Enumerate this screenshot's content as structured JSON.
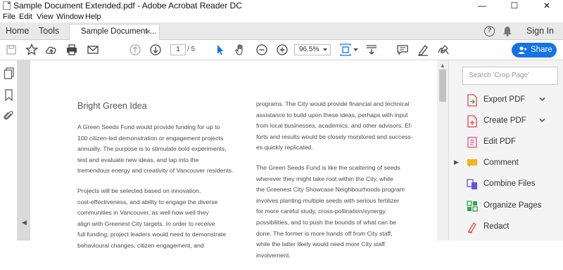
{
  "window": {
    "title": "Sample Document Extended.pdf - Adobe Acrobat Reader DC",
    "controls": {
      "minimize": "—",
      "maximize": "☐",
      "close": "✕"
    }
  },
  "menu": [
    "File",
    "Edit",
    "View",
    "Window",
    "Help"
  ],
  "tabs": {
    "home": "Home",
    "tools": "Tools",
    "document": "Sample Document ...",
    "close_glyph": "×",
    "help_glyph": "?",
    "sign_in": "Sign In"
  },
  "toolbar": {
    "icons": [
      "save-icon",
      "star-icon",
      "upload-icon",
      "print-icon",
      "mail-icon",
      "page-up-icon",
      "page-down-icon",
      "select-cursor-icon",
      "hand-icon",
      "zoom-out-icon",
      "zoom-in-icon",
      "page-fit-icon",
      "scroll-mode-icon",
      "comment-icon",
      "highlight-pen-icon",
      "sign-icon"
    ],
    "current_page": "1",
    "total_pages": "/ 5",
    "zoom": "96.5%",
    "share": "Share",
    "accent_color": "#1473e6"
  },
  "document": {
    "heading": "Bright Green Idea",
    "left_column": [
      [
        "A Green Seeds Fund would provide funding for up to",
        "100 citizen-led demonstration or engagement projects",
        "annually. The purpose is to stimulate bold experiments,",
        "test and evaluate new ideas, and tap into the",
        "tremendous energy and creativity of Vancouver residents."
      ],
      [
        "Projects will be selected based on innovation,",
        "cost-effectiveness, and ability to engage the diverse",
        "communities in Vancouver, as well how well they",
        "align with Greenest City targets. In order to receive",
        "full funding, project leaders would need to demonstrate",
        "behavioural changes, citizen engagement, and"
      ]
    ],
    "right_column": [
      [
        "programs. The City would provide financial and technical",
        "assistance to build upon these ideas, perhaps with input",
        "from local businesses, academics, and other advisors. Ef-",
        "forts and results would be closely monitored and success-",
        "es quickly replicated."
      ],
      [
        "The Green Seeds Fund is like the scattering of seeds",
        "wherever they might take root within the City, while",
        "the Greenest City Showcase Neighbourhoods program",
        "involves planting multiple seeds with serious fertilizer",
        "for more careful study, cross-pollination/synergy",
        "possibilities, and to push the bounds of what can be",
        "done. The former is more hands off from City staff,",
        "while the latter likely would need more City staff",
        "involvement."
      ]
    ]
  },
  "right_pane": {
    "search_placeholder": "Search 'Crop Page'",
    "tools": [
      {
        "label": "Export PDF",
        "icon": "export-pdf-icon",
        "color": "#e34850",
        "expandable": true
      },
      {
        "label": "Create PDF",
        "icon": "create-pdf-icon",
        "color": "#e34850",
        "expandable": true
      },
      {
        "label": "Edit PDF",
        "icon": "edit-pdf-icon",
        "color": "#e6508b",
        "expandable": false
      },
      {
        "label": "Comment",
        "icon": "comment-icon",
        "color": "#f5b321",
        "expandable": false
      },
      {
        "label": "Combine Files",
        "icon": "combine-files-icon",
        "color": "#6553d6",
        "expandable": false
      },
      {
        "label": "Organize Pages",
        "icon": "organize-pages-icon",
        "color": "#2da44e",
        "expandable": false
      },
      {
        "label": "Redact",
        "icon": "redact-icon",
        "color": "#e34850",
        "expandable": false
      }
    ]
  }
}
